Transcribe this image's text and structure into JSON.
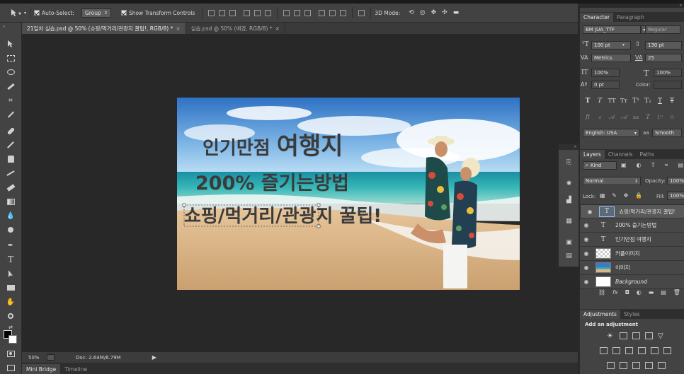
{
  "options_bar": {
    "auto_select_label": "Auto-Select:",
    "auto_select_value": "Group",
    "transform_controls_label": "Show Transform Controls",
    "mode_3d_label": "3D Mode:"
  },
  "document_tabs": [
    {
      "label": "21일차 실습.psd @ 50% (쇼핑/먹거리/관광지 꿀팁!, RGB/8) *",
      "active": true
    },
    {
      "label": "실습.psd @ 50% (배경, RGB/8) *",
      "active": false
    }
  ],
  "canvas_text": {
    "line1_small": "인기만점 ",
    "line1_large": "여행지",
    "line2": "200% 즐기는방법",
    "line3": "쇼핑/먹거리/관광지 꿀팁!"
  },
  "status": {
    "zoom": "50%",
    "doc": "Doc: 2.64M/6.79M"
  },
  "bottom_tabs": [
    {
      "label": "Mini Bridge",
      "active": true
    },
    {
      "label": "Timeline",
      "active": false
    }
  ],
  "character_panel": {
    "tabs": [
      "Character",
      "Paragraph"
    ],
    "font_family": "BM JUA_TTF",
    "font_style": "Regular",
    "font_size": "100 pt",
    "leading": "130 pt",
    "kerning": "Metrics",
    "tracking": "25",
    "vertical_scale": "100%",
    "horizontal_scale": "100%",
    "baseline_shift": "0 pt",
    "color_label": "Color:",
    "language": "English: USA",
    "antialias_prefix": "aa",
    "antialias": "Smooth"
  },
  "layers_panel": {
    "tabs": [
      "Layers",
      "Channels",
      "Paths"
    ],
    "filter_kind": "Kind",
    "blend_mode": "Normal",
    "opacity_label": "Opacity:",
    "opacity": "100%",
    "lock_label": "Lock:",
    "fill_label": "Fill:",
    "fill": "100%",
    "layers": [
      {
        "name": "쇼핑/먹거리/관광지 꿀팁!",
        "type": "text",
        "selected": true
      },
      {
        "name": "200% 즐기는방법",
        "type": "text",
        "selected": false
      },
      {
        "name": "인기만점 여행지",
        "type": "text",
        "selected": false
      },
      {
        "name": "커플이미지",
        "type": "smart",
        "selected": false
      },
      {
        "name": "이미지",
        "type": "image",
        "selected": false
      },
      {
        "name": "Background",
        "type": "background",
        "selected": false
      }
    ]
  },
  "adjustments_panel": {
    "tabs": [
      "Adjustments",
      "Styles"
    ],
    "heading": "Add an adjustment"
  }
}
